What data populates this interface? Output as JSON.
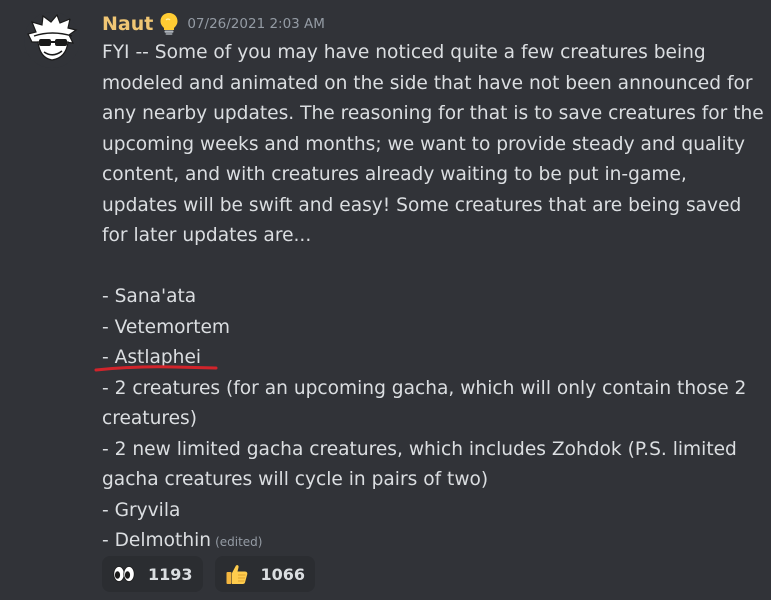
{
  "message": {
    "author": "Naut",
    "author_badge_icon": "lightbulb-icon",
    "timestamp": "07/26/2021 2:03 AM",
    "edited_label": "(edited)",
    "lines": [
      "FYI -- Some of you may have noticed quite a few creatures being modeled and animated on the side that have not been announced for any nearby updates. The reasoning for that is to save creatures for the upcoming weeks and months; we want to provide steady and quality content, and with creatures already waiting to be put in-game, updates will be swift and easy! Some creatures that are being saved for later updates are...",
      "",
      "- Sana'ata",
      "- Vetemortem",
      "- Astlaphei",
      "- 2 creatures (for an upcoming gacha, which will only contain those 2 creatures)",
      "- 2 new limited gacha creatures, which includes Zohdok (P.S. limited gacha creatures will cycle in pairs of two)",
      "- Gryvila",
      "- Delmothin"
    ]
  },
  "reactions": [
    {
      "emoji": "eyes-icon",
      "count": "1193"
    },
    {
      "emoji": "thumbs-up-icon",
      "count": "1066"
    }
  ],
  "colors": {
    "background": "#313338",
    "username": "#f0c674",
    "text": "#dbdee1",
    "muted": "#949ba4",
    "annotation_underline": "#d1242b",
    "reaction_bg": "#2b2d31"
  }
}
